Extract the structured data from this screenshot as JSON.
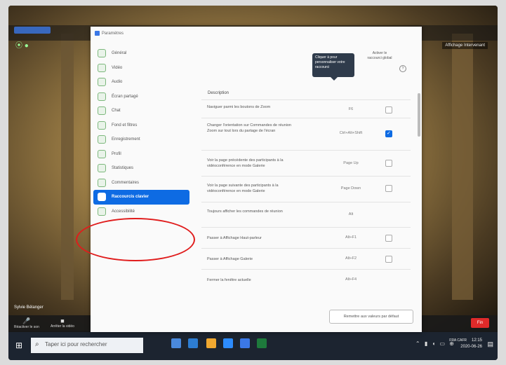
{
  "window": {
    "settings_title": "Paramètres"
  },
  "zoom_bar": {
    "speaker_view": "Affichage Intervenant",
    "participant_name": "Sylvie Bélanger",
    "unmute": "Réactiver le son",
    "start_video": "Arrêter la vidéo",
    "end": "Fin"
  },
  "sidebar": {
    "items": [
      {
        "label": "Général",
        "icon": "general-icon"
      },
      {
        "label": "Vidéo",
        "icon": "video-icon"
      },
      {
        "label": "Audio",
        "icon": "audio-icon"
      },
      {
        "label": "Écran partagé",
        "icon": "share-screen-icon"
      },
      {
        "label": "Chat",
        "icon": "chat-icon"
      },
      {
        "label": "Fond et filtres",
        "icon": "background-icon"
      },
      {
        "label": "Enregistrement",
        "icon": "recording-icon"
      },
      {
        "label": "Profil",
        "icon": "profile-icon"
      },
      {
        "label": "Statistiques",
        "icon": "statistics-icon"
      },
      {
        "label": "Commentaires",
        "icon": "feedback-icon"
      },
      {
        "label": "Raccourcis clavier",
        "icon": "keyboard-icon",
        "active": true
      },
      {
        "label": "Accessibilité",
        "icon": "accessibility-icon"
      }
    ]
  },
  "shortcuts": {
    "col_description": "Description",
    "col_global": "Activer le raccourci global",
    "tooltip": "Cliquer à pour personnaliser votre raccourci",
    "rows": [
      {
        "desc": "Naviguer parmi les boutons de Zoom",
        "key": "F6",
        "checked": false
      },
      {
        "desc": "Changer l'orientation sur Commandes de réunion Zoom sur tout lors du partage de l'écran",
        "key": "Ctrl+Alt+Shift",
        "checked": true
      },
      {
        "desc": "Voir la page précédente des participants à la vidéoconférence en mode Galerie",
        "key": "Page Up",
        "checked": false
      },
      {
        "desc": "Voir la page suivante des participants à la vidéoconférence en mode Galerie",
        "key": "Page Down",
        "checked": false
      },
      {
        "desc": "Toujours afficher les commandes de réunion",
        "key": "Alt",
        "checked": null
      },
      {
        "desc": "Passer à Affichage Haut-parleur",
        "key": "Alt+F1",
        "checked": false
      },
      {
        "desc": "Passer à Affichage Galerie",
        "key": "Alt+F2",
        "checked": false
      },
      {
        "desc": "Fermer la fenêtre actuelle",
        "key": "Alt+F4",
        "checked": null
      }
    ],
    "reset_label": "Remettre aux valeurs par défaut"
  },
  "taskbar": {
    "search_placeholder": "Taper ici pour rechercher",
    "lang": "FRA CAFR",
    "time": "12:15",
    "date": "2020-06-26"
  }
}
